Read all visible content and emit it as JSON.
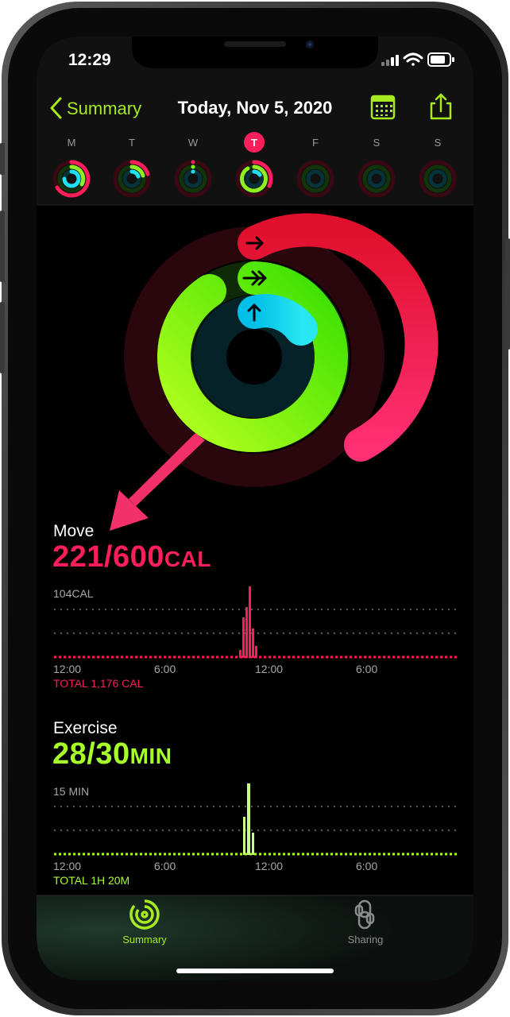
{
  "status_bar": {
    "time": "12:29"
  },
  "nav": {
    "back_label": "Summary",
    "title": "Today, Nov 5, 2020"
  },
  "week": {
    "days": [
      "M",
      "T",
      "W",
      "T",
      "F",
      "S",
      "S"
    ],
    "selected_index": 3
  },
  "move": {
    "label": "Move",
    "value": "221/600",
    "unit": "CAL",
    "chart_max_label": "104CAL",
    "x_ticks": [
      "12:00",
      "6:00",
      "12:00",
      "6:00"
    ],
    "total": "TOTAL 1,176 CAL"
  },
  "exercise": {
    "label": "Exercise",
    "value": "28/30",
    "unit": "MIN",
    "chart_max_label": "15 MIN",
    "x_ticks": [
      "12:00",
      "6:00",
      "12:00",
      "6:00"
    ],
    "total": "TOTAL 1H 20M"
  },
  "tabs": [
    {
      "label": "Summary",
      "icon": "activity-rings-icon",
      "active": true
    },
    {
      "label": "Sharing",
      "icon": "sharing-icon",
      "active": false
    }
  ],
  "colors": {
    "move": "#fa1e5a",
    "exercise": "#a6ff2a",
    "stand": "#1ee0f0",
    "accent": "#a6ea1f",
    "annotation_arrow": "#f2306a"
  }
}
